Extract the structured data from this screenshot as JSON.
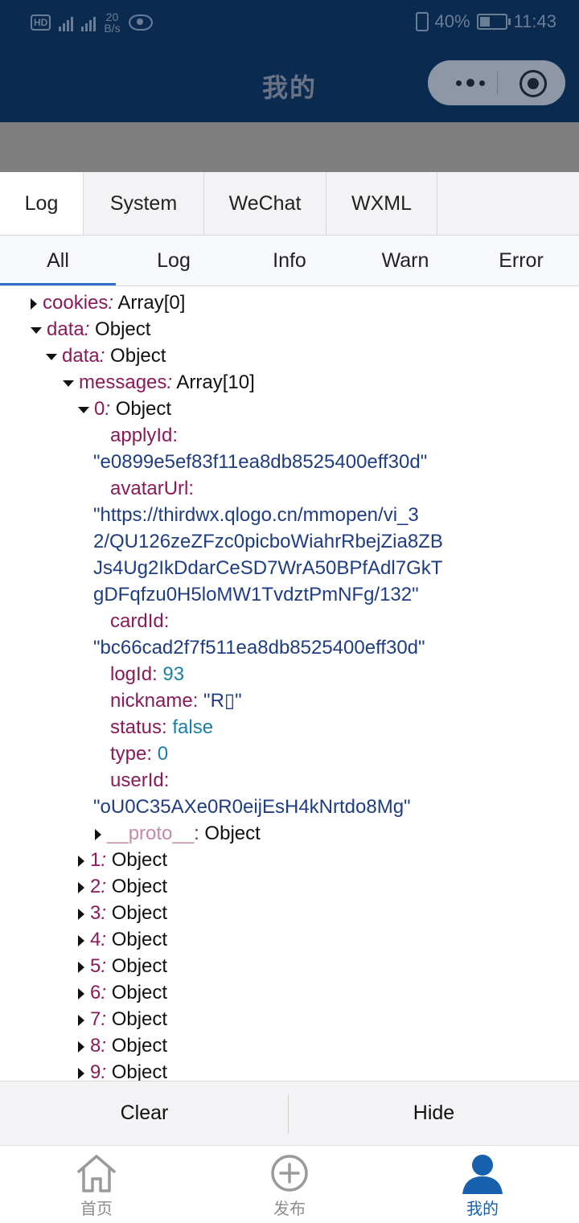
{
  "status_bar": {
    "speed_top": "20",
    "speed_unit": "B/s",
    "battery": "40%",
    "time": "11:43"
  },
  "nav": {
    "title": "我的"
  },
  "console": {
    "tabs": [
      "Log",
      "System",
      "WeChat",
      "WXML"
    ],
    "filters": [
      "All",
      "Log",
      "Info",
      "Warn",
      "Error"
    ],
    "rows": [
      {
        "indent": 0,
        "arrow": "right",
        "key": "cookies",
        "sep": ":",
        "val": " Array[0]",
        "type": "plain",
        "italic": true
      },
      {
        "indent": 0,
        "arrow": "down",
        "key": "data",
        "sep": ":",
        "val": " Object",
        "type": "plain",
        "italic": true
      },
      {
        "indent": 1,
        "arrow": "down",
        "key": "data",
        "sep": ":",
        "val": " Object",
        "type": "plain",
        "italic": true
      },
      {
        "indent": 2,
        "arrow": "down",
        "key": "messages",
        "sep": ":",
        "val": " Array[10]",
        "type": "plain",
        "italic": true
      },
      {
        "indent": 3,
        "arrow": "down",
        "key": "0",
        "sep": ":",
        "val": " Object",
        "type": "plain",
        "italic": true
      },
      {
        "indent": 4,
        "arrow": "",
        "key": "applyId",
        "sep": ":",
        "val": "",
        "type": "plain"
      },
      {
        "indent": -1,
        "arrow": "",
        "key": "",
        "sep": "",
        "val": "\"e0899e5ef83f11ea8db8525400eff30d\"",
        "type": "str"
      },
      {
        "indent": 4,
        "arrow": "",
        "key": "avatarUrl",
        "sep": ":",
        "val": "",
        "type": "plain"
      },
      {
        "indent": -1,
        "arrow": "",
        "key": "",
        "sep": "",
        "val": "\"https://thirdwx.qlogo.cn/mmopen/vi_3",
        "type": "str"
      },
      {
        "indent": -1,
        "arrow": "",
        "key": "",
        "sep": "",
        "val": "2/QU126zeZFzc0picboWiahrRbejZia8ZB",
        "type": "str"
      },
      {
        "indent": -1,
        "arrow": "",
        "key": "",
        "sep": "",
        "val": "Js4Ug2IkDdarCeSD7WrA50BPfAdl7GkT",
        "type": "str"
      },
      {
        "indent": -1,
        "arrow": "",
        "key": "",
        "sep": "",
        "val": "gDFqfzu0H5loMW1TvdztPmNFg/132\"",
        "type": "str"
      },
      {
        "indent": 4,
        "arrow": "",
        "key": "cardId",
        "sep": ":",
        "val": "",
        "type": "plain"
      },
      {
        "indent": -1,
        "arrow": "",
        "key": "",
        "sep": "",
        "val": "\"bc66cad2f7f511ea8db8525400eff30d\"",
        "type": "str"
      },
      {
        "indent": 4,
        "arrow": "",
        "key": "logId",
        "sep": ":",
        "val": " 93",
        "type": "num"
      },
      {
        "indent": 4,
        "arrow": "",
        "key": "nickname",
        "sep": ":",
        "val": " \"R▯\"",
        "type": "str"
      },
      {
        "indent": 4,
        "arrow": "",
        "key": "status",
        "sep": ":",
        "val": " false",
        "type": "num"
      },
      {
        "indent": 4,
        "arrow": "",
        "key": "type",
        "sep": ":",
        "val": " 0",
        "type": "num"
      },
      {
        "indent": 4,
        "arrow": "",
        "key": "userId",
        "sep": ":",
        "val": "",
        "type": "plain"
      },
      {
        "indent": -1,
        "arrow": "",
        "key": "",
        "sep": "",
        "val": "\"oU0C35AXe0R0eijEsH4kNrtdo8Mg\"",
        "type": "str"
      },
      {
        "indent": 4,
        "arrow": "right",
        "key": "__proto__",
        "sep": ":",
        "val": " Object",
        "type": "plain",
        "proto": true
      },
      {
        "indent": 3,
        "arrow": "right",
        "key": "1",
        "sep": ":",
        "val": " Object",
        "type": "plain",
        "italic": true
      },
      {
        "indent": 3,
        "arrow": "right",
        "key": "2",
        "sep": ":",
        "val": " Object",
        "type": "plain",
        "italic": true
      },
      {
        "indent": 3,
        "arrow": "right",
        "key": "3",
        "sep": ":",
        "val": " Object",
        "type": "plain",
        "italic": true
      },
      {
        "indent": 3,
        "arrow": "right",
        "key": "4",
        "sep": ":",
        "val": " Object",
        "type": "plain",
        "italic": true
      },
      {
        "indent": 3,
        "arrow": "right",
        "key": "5",
        "sep": ":",
        "val": " Object",
        "type": "plain",
        "italic": true
      },
      {
        "indent": 3,
        "arrow": "right",
        "key": "6",
        "sep": ":",
        "val": " Object",
        "type": "plain",
        "italic": true
      },
      {
        "indent": 3,
        "arrow": "right",
        "key": "7",
        "sep": ":",
        "val": " Object",
        "type": "plain",
        "italic": true
      },
      {
        "indent": 3,
        "arrow": "right",
        "key": "8",
        "sep": ":",
        "val": " Object",
        "type": "plain",
        "italic": true
      },
      {
        "indent": 3,
        "arrow": "right",
        "key": "9",
        "sep": ":",
        "val": " Object",
        "type": "plain",
        "italic": true
      }
    ],
    "buttons": {
      "clear": "Clear",
      "hide": "Hide"
    }
  },
  "tabbar": {
    "items": [
      {
        "label": "首页",
        "icon": "home-icon"
      },
      {
        "label": "发布",
        "icon": "plus-circle-icon"
      },
      {
        "label": "我的",
        "icon": "user-icon",
        "active": true
      }
    ]
  },
  "colors": {
    "nav_bg": "#0b2a4f",
    "accent": "#1660ad",
    "key": "#8a1a5a",
    "string": "#1f3d83",
    "number": "#1a7fa6"
  }
}
